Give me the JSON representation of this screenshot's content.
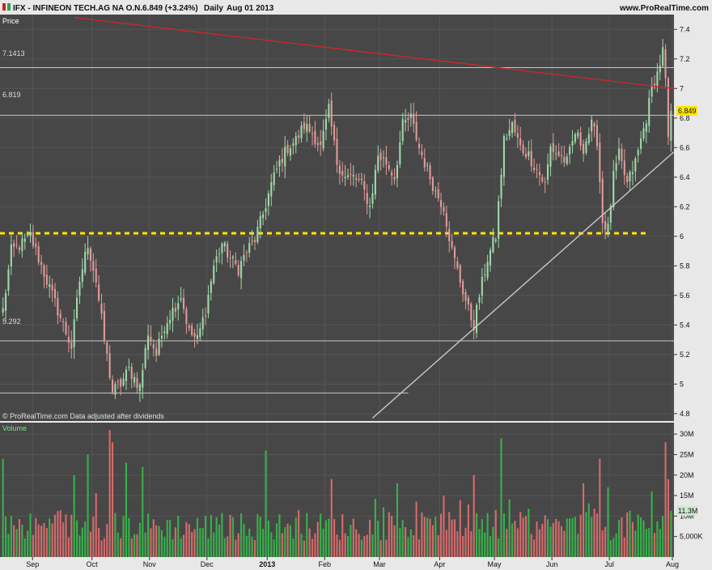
{
  "header": {
    "instrument": "IFX - INFINEON TECH.AG NA O.N.",
    "quote": "6.849 (+3.24%)",
    "period": "Daily",
    "date": "Aug 01 2013",
    "brand": "www.ProRealTime.com"
  },
  "price_panel": {
    "label": "Price",
    "footer": "© ProRealTime.com  Data adjusted after dividends",
    "current_value": "6.849",
    "level_labels": [
      "7.1413",
      "6.819",
      "5.292"
    ]
  },
  "volume_panel": {
    "label": "Volume",
    "current_value": "11.3M"
  },
  "colors": {
    "panel_bg": "#474747",
    "page_bg": "#e8e8e8",
    "up": "#9fd9a8",
    "down": "#e39a9a",
    "vol_up": "#36b24a",
    "vol_down": "#d86a6a",
    "resistance": "#c52a2a",
    "support_dotted": "#ffe600",
    "horizontal_lines": "#c8c8c8",
    "trend_up": "#c8c8c8",
    "price_badge": "#ffe600",
    "volume_badge": "#cfe8cf"
  },
  "chart_data": {
    "type": "candlestick",
    "title": "IFX - INFINEON TECH.AG NA O.N.",
    "x_axis": {
      "month_labels": [
        "Sep",
        "Oct",
        "Nov",
        "Dec",
        "2013",
        "Feb",
        "Mar",
        "Apr",
        "May",
        "Jun",
        "Jul",
        "Aug"
      ],
      "month_positions": [
        10.8,
        32.5,
        53.5,
        74.5,
        96.5,
        117.5,
        137.5,
        159.5,
        179.5,
        200.5,
        221.5,
        244.5
      ],
      "total_sessions": 245
    },
    "y_axis_price": {
      "range": [
        4.75,
        7.5
      ],
      "ticks": [
        4.8,
        5,
        5.2,
        5.4,
        5.6,
        5.8,
        6,
        6.2,
        6.4,
        6.6,
        6.8,
        7,
        7.2,
        7.4
      ],
      "tick_labels": [
        "4.8",
        "5",
        "5.2",
        "5.4",
        "5.6",
        "5.8",
        "6",
        "6.2",
        "6.4",
        "6.6",
        "6.8",
        "7",
        "7.2",
        "7.4"
      ]
    },
    "y_axis_volume": {
      "range": [
        0,
        32000000
      ],
      "ticks": [
        5000000,
        10000000,
        15000000,
        20000000,
        25000000,
        30000000
      ],
      "tick_labels": [
        "5,000K",
        "10M",
        "15M",
        "20M",
        "25M",
        "30M"
      ]
    },
    "close_anchors": [
      [
        0,
        5.5
      ],
      [
        3,
        5.9
      ],
      [
        7,
        5.95
      ],
      [
        10,
        6.0
      ],
      [
        14,
        5.8
      ],
      [
        18,
        5.6
      ],
      [
        22,
        5.4
      ],
      [
        25,
        5.25
      ],
      [
        28,
        5.7
      ],
      [
        31,
        5.95
      ],
      [
        34,
        5.7
      ],
      [
        37,
        5.3
      ],
      [
        40,
        4.95
      ],
      [
        43,
        5.0
      ],
      [
        46,
        5.1
      ],
      [
        50,
        4.98
      ],
      [
        53,
        5.35
      ],
      [
        56,
        5.2
      ],
      [
        59,
        5.4
      ],
      [
        62,
        5.5
      ],
      [
        65,
        5.6
      ],
      [
        68,
        5.35
      ],
      [
        71,
        5.3
      ],
      [
        74,
        5.5
      ],
      [
        77,
        5.8
      ],
      [
        80,
        5.95
      ],
      [
        83,
        5.85
      ],
      [
        86,
        5.78
      ],
      [
        89,
        5.9
      ],
      [
        92,
        5.98
      ],
      [
        95,
        6.15
      ],
      [
        98,
        6.35
      ],
      [
        101,
        6.5
      ],
      [
        104,
        6.6
      ],
      [
        107,
        6.65
      ],
      [
        110,
        6.75
      ],
      [
        113,
        6.7
      ],
      [
        116,
        6.6
      ],
      [
        119,
        6.85
      ],
      [
        122,
        6.5
      ],
      [
        125,
        6.4
      ],
      [
        128,
        6.4
      ],
      [
        131,
        6.35
      ],
      [
        134,
        6.2
      ],
      [
        137,
        6.55
      ],
      [
        140,
        6.5
      ],
      [
        143,
        6.4
      ],
      [
        146,
        6.75
      ],
      [
        149,
        6.8
      ],
      [
        152,
        6.6
      ],
      [
        155,
        6.45
      ],
      [
        158,
        6.3
      ],
      [
        161,
        6.2
      ],
      [
        164,
        5.9
      ],
      [
        167,
        5.7
      ],
      [
        170,
        5.5
      ],
      [
        172,
        5.4
      ],
      [
        174,
        5.6
      ],
      [
        177,
        5.85
      ],
      [
        180,
        6.0
      ],
      [
        183,
        6.65
      ],
      [
        186,
        6.75
      ],
      [
        189,
        6.6
      ],
      [
        192,
        6.55
      ],
      [
        195,
        6.45
      ],
      [
        198,
        6.35
      ],
      [
        200,
        6.6
      ],
      [
        203,
        6.55
      ],
      [
        206,
        6.5
      ],
      [
        209,
        6.7
      ],
      [
        212,
        6.6
      ],
      [
        215,
        6.75
      ],
      [
        217,
        6.65
      ],
      [
        219,
        6.1
      ],
      [
        221,
        6.05
      ],
      [
        223,
        6.4
      ],
      [
        225,
        6.55
      ],
      [
        228,
        6.35
      ],
      [
        231,
        6.5
      ],
      [
        233,
        6.65
      ],
      [
        235,
        6.8
      ],
      [
        237,
        7.0
      ],
      [
        239,
        7.1
      ],
      [
        241,
        7.25
      ],
      [
        242,
        7.05
      ],
      [
        243,
        6.63
      ],
      [
        244,
        6.849
      ]
    ],
    "levels": {
      "resistance_top": 7.1413,
      "resistance_mid": 6.819,
      "support_dotted": 6.02,
      "support_low": 5.292,
      "bottom_line": 4.94
    },
    "trendlines": {
      "falling_resistance": {
        "from": [
          26,
          7.48
        ],
        "to": [
          245,
          7.0
        ]
      },
      "rising_support": {
        "from": [
          135,
          4.77
        ],
        "to": [
          245,
          6.57
        ]
      }
    },
    "last_close": 6.849,
    "last_volume": 11300000
  }
}
